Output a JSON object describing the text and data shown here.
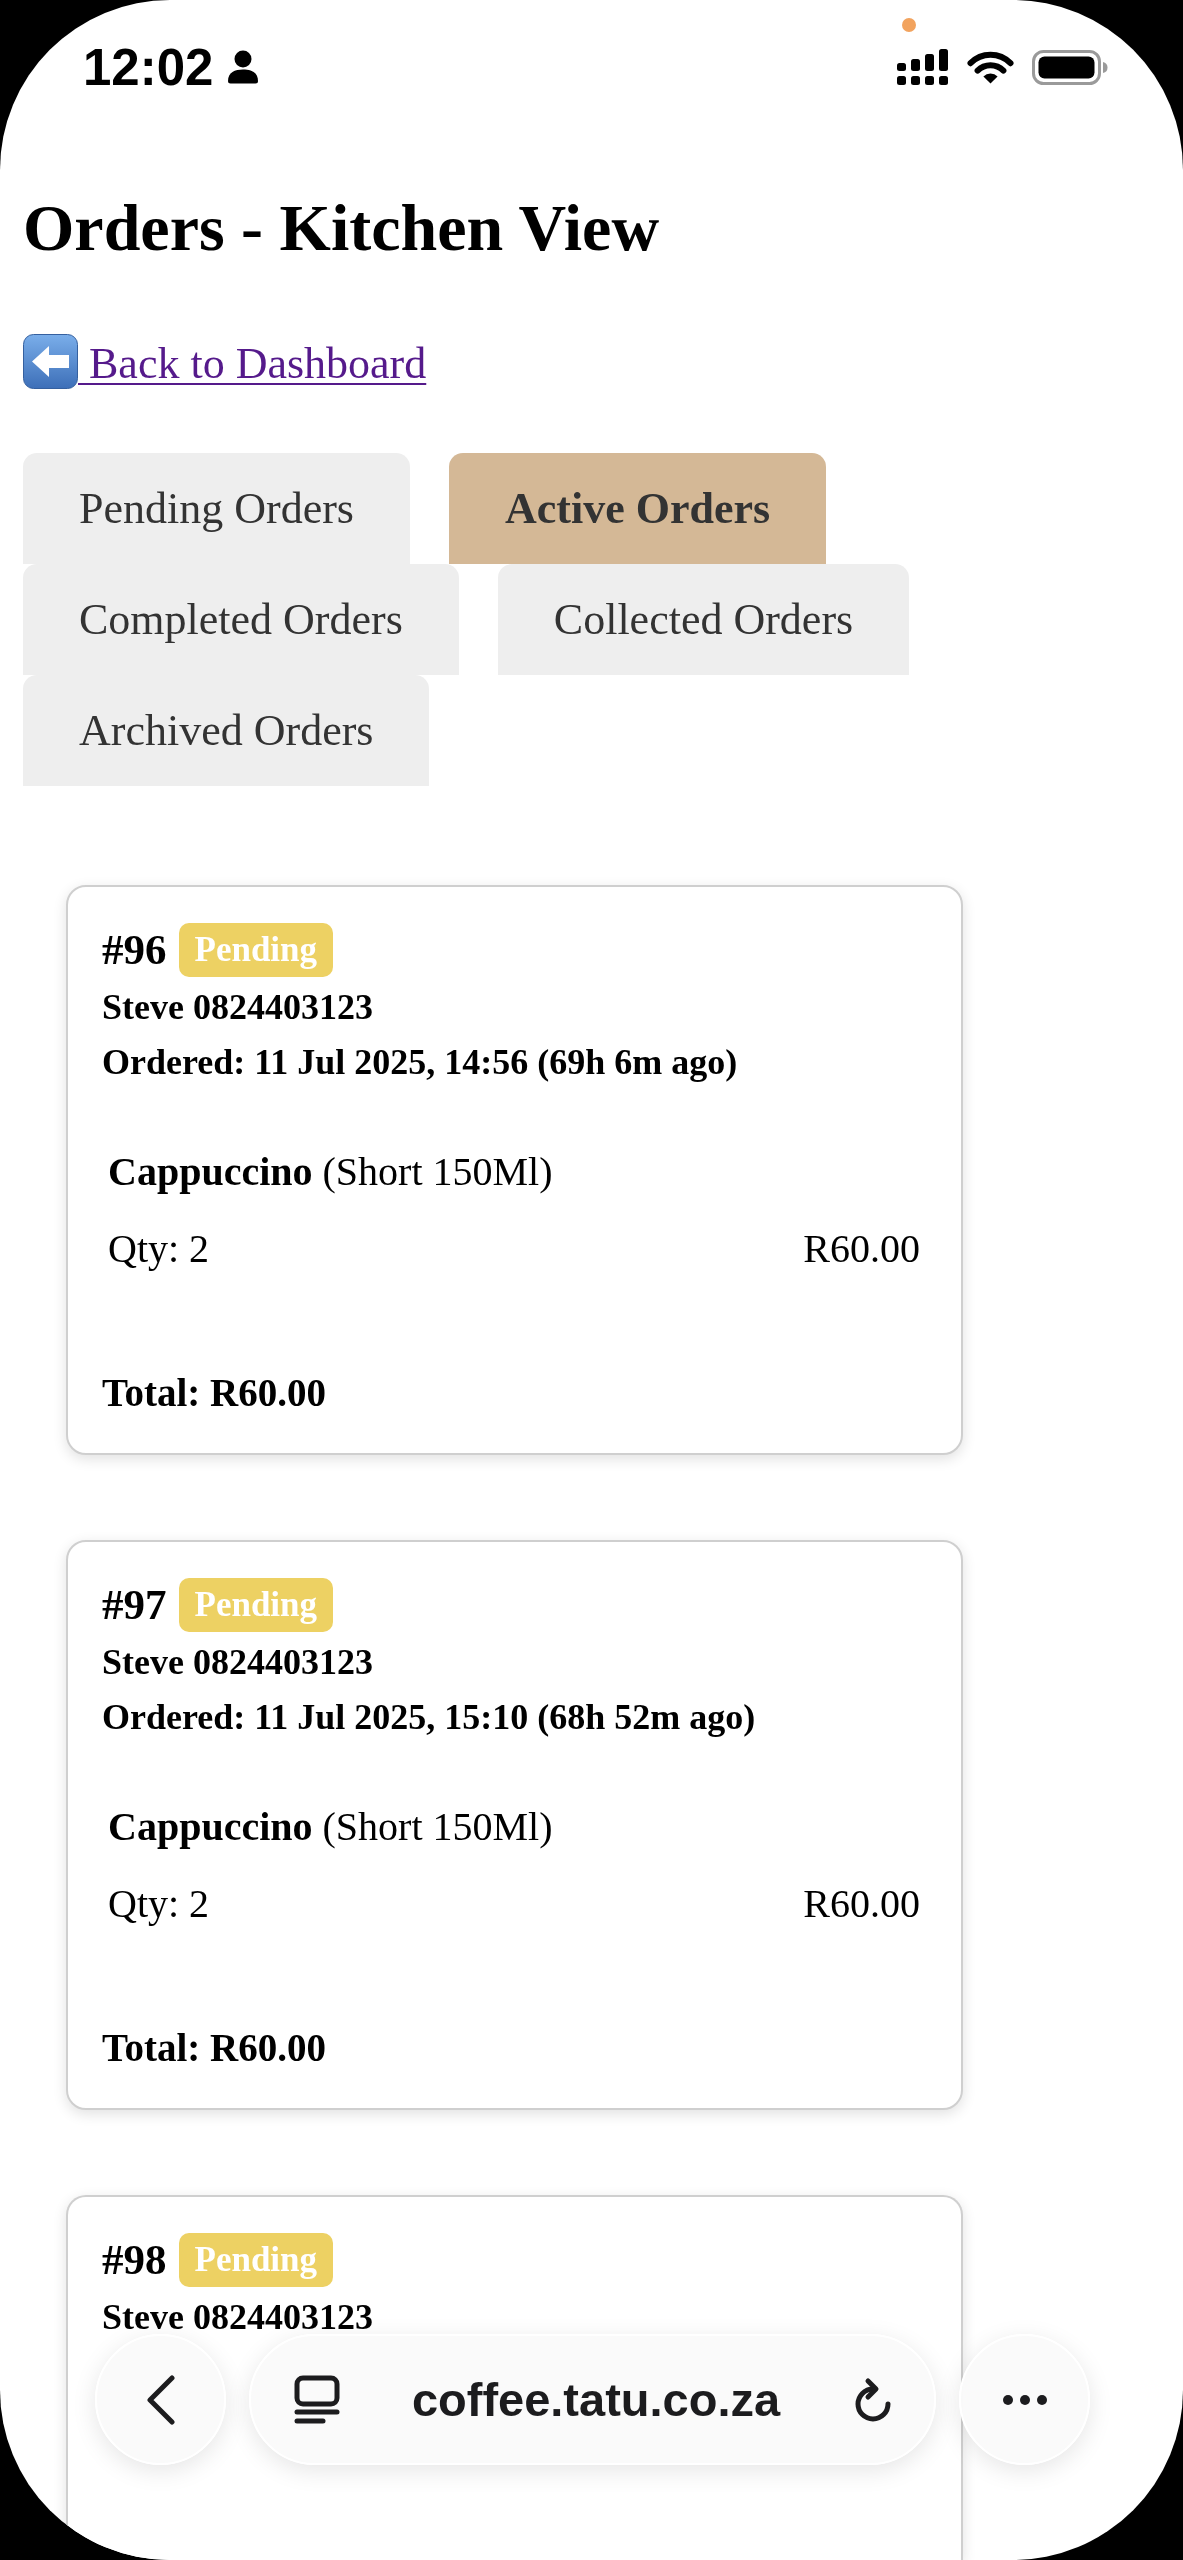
{
  "status_bar": {
    "time": "12:02"
  },
  "page": {
    "title": "Orders - Kitchen View",
    "back_link": "Back to Dashboard"
  },
  "tabs": [
    {
      "label": "Pending Orders",
      "selected": false
    },
    {
      "label": "Active Orders",
      "selected": true
    },
    {
      "label": "Completed Orders",
      "selected": false
    },
    {
      "label": "Collected Orders",
      "selected": false
    },
    {
      "label": "Archived Orders",
      "selected": false
    }
  ],
  "orders": [
    {
      "number": "#96",
      "status": {
        "label": "Pending",
        "color": "#edd163"
      },
      "customer": "Steve 0824403123",
      "ordered": "Ordered: 11 Jul 2025, 14:56 (69h 6m ago)",
      "items": [
        {
          "name": "**Cappuccino** (Short 150Ml)",
          "quantity": "Qty: 2",
          "price": "R60.00"
        }
      ],
      "total": "Total: R60.00"
    },
    {
      "number": "#97",
      "status": {
        "label": "Pending",
        "color": "#edd163"
      },
      "customer": "Steve 0824403123",
      "ordered": "Ordered: 11 Jul 2025, 15:10 (68h 52m ago)",
      "items": [
        {
          "name": "**Cappuccino** (Short 150Ml)",
          "quantity": "Qty: 2",
          "price": "R60.00"
        }
      ],
      "total": "Total: R60.00"
    },
    {
      "number": "#98",
      "status": {
        "label": "Pending",
        "color": "#edd163"
      },
      "customer": "Steve 0824403123"
    }
  ],
  "browser": {
    "url": "coffee.tatu.co.za"
  }
}
